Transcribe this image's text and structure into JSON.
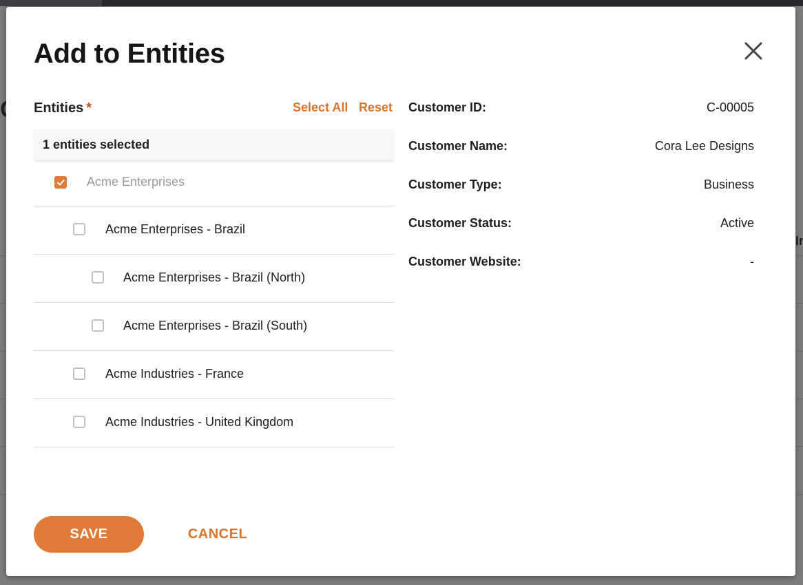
{
  "modal": {
    "title": "Add to Entities"
  },
  "entities": {
    "label": "Entities",
    "required_mark": "*",
    "select_all": "Select All",
    "reset": "Reset",
    "selected_summary": "1 entities selected",
    "items": [
      {
        "label": "Acme Enterprises",
        "level": 0,
        "checked": true
      },
      {
        "label": "Acme Enterprises - Brazil",
        "level": 1,
        "checked": false
      },
      {
        "label": "Acme Enterprises - Brazil (North)",
        "level": 2,
        "checked": false
      },
      {
        "label": "Acme Enterprises - Brazil (South)",
        "level": 2,
        "checked": false
      },
      {
        "label": "Acme Industries - France",
        "level": 1,
        "checked": false
      },
      {
        "label": "Acme Industries - United Kingdom",
        "level": 1,
        "checked": false
      }
    ]
  },
  "customer": {
    "rows": [
      {
        "key": "Customer ID:",
        "value": "C-00005"
      },
      {
        "key": "Customer Name:",
        "value": "Cora Lee Designs"
      },
      {
        "key": "Customer Type:",
        "value": "Business"
      },
      {
        "key": "Customer Status:",
        "value": "Active"
      },
      {
        "key": "Customer Website:",
        "value": "-"
      }
    ]
  },
  "footer": {
    "save_label": "SAVE",
    "cancel_label": "CANCEL"
  },
  "colors": {
    "accent": "#e07a35",
    "required": "#d04a2a"
  },
  "icons": {
    "close": "close-icon",
    "check": "checkmark-icon"
  }
}
